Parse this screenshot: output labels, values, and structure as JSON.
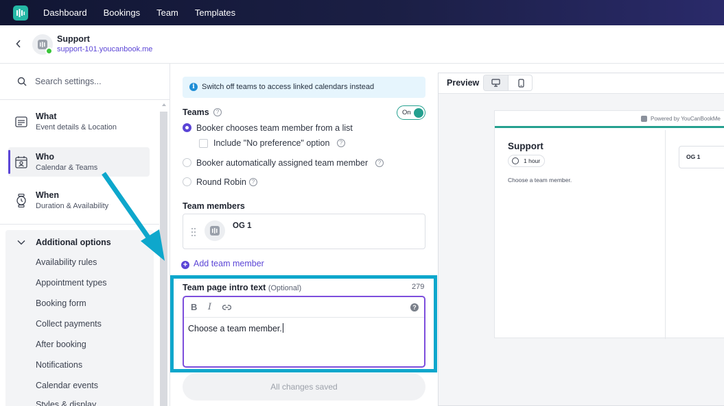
{
  "nav": {
    "items": [
      "Dashboard",
      "Bookings",
      "Team",
      "Templates"
    ]
  },
  "header": {
    "title": "Support",
    "url": "support-101.youcanbook.me"
  },
  "sidebar": {
    "search_placeholder": "Search settings...",
    "sections": [
      {
        "title": "What",
        "subtitle": "Event details & Location",
        "icon": "card-icon"
      },
      {
        "title": "Who",
        "subtitle": "Calendar & Teams",
        "icon": "person-calendar-icon"
      },
      {
        "title": "When",
        "subtitle": "Duration & Availability",
        "icon": "watch-icon"
      }
    ],
    "additional_title": "Additional options",
    "additional_items": [
      "Availability rules",
      "Appointment types",
      "Booking form",
      "Collect payments",
      "After booking",
      "Notifications",
      "Calendar events",
      "Styles & display"
    ]
  },
  "teams": {
    "info_text": "Switch off teams to access linked calendars instead",
    "label": "Teams",
    "toggle_label": "On",
    "options": [
      "Booker chooses team member from a list",
      "Booker automatically assigned team member",
      "Round Robin"
    ],
    "no_preference_label": "Include \"No preference\" option",
    "members_label": "Team members",
    "members": [
      "OG 1"
    ],
    "add_member_label": "Add team member",
    "intro_label": "Team page intro text",
    "intro_optional": "(Optional)",
    "intro_count": "279",
    "intro_text": "Choose a team member.",
    "save_label": "All changes saved"
  },
  "preview": {
    "label": "Preview",
    "powered_by": "Powered by YouCanBookMe",
    "title": "Support",
    "duration": "1 hour",
    "description": "Choose a team member.",
    "member": "OG 1"
  },
  "colors": {
    "accent": "#5b45d6",
    "teal": "#24a08f",
    "highlight": "#0ea7cc"
  }
}
